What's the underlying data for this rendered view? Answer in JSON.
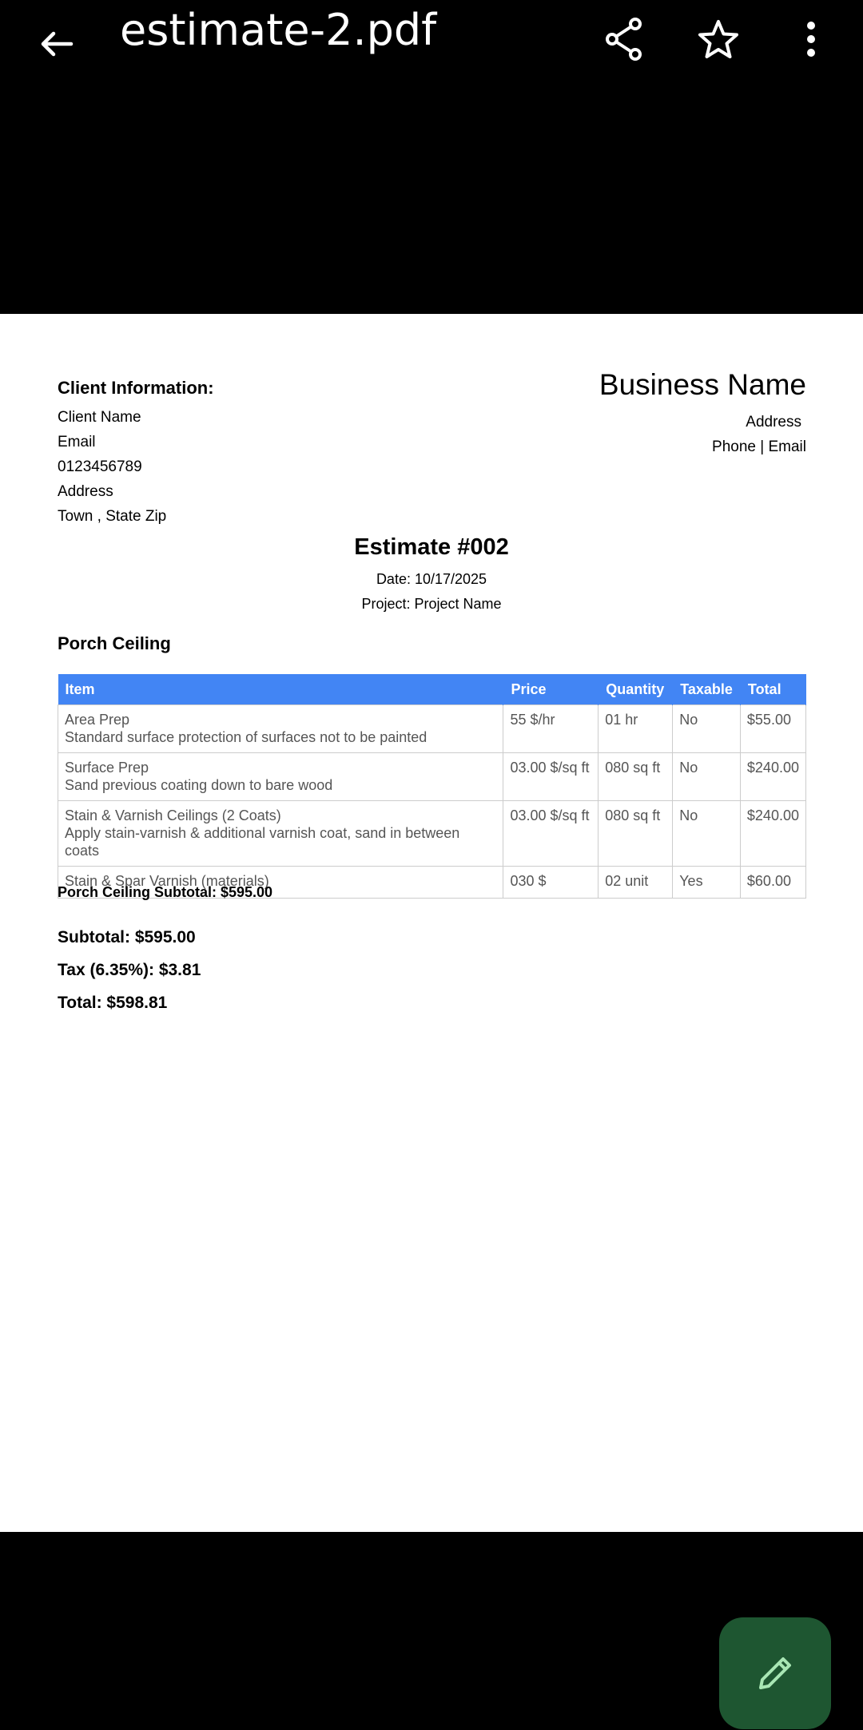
{
  "topbar": {
    "title": "estimate-2.pdf",
    "back_icon": "arrow-back-icon",
    "share_icon": "share-icon",
    "star_icon": "star-outline-icon",
    "more_icon": "more-vert-icon"
  },
  "document": {
    "client": {
      "heading": "Client Information:",
      "lines": [
        "Client  Name",
        "Email",
        "0123456789",
        "Address",
        "Town , State Zip"
      ]
    },
    "business": {
      "name": "Business Name",
      "address": "Address",
      "contact": "Phone | Email"
    },
    "estimate": {
      "title": "Estimate #002",
      "date": "Date: 10/17/2025",
      "project": "Project: Project Name"
    },
    "section": {
      "title": "Porch Ceiling",
      "subtotal": "Porch Ceiling  Subtotal: $595.00"
    },
    "table": {
      "headers": [
        "Item",
        "Price",
        "Quantity",
        "Taxable",
        "Total"
      ],
      "rows": [
        {
          "item": "Area Prep",
          "desc": "Standard surface protection of surfaces not to be painted",
          "price": "55 $/hr",
          "qty": "01 hr",
          "taxable": "No",
          "total": "$55.00"
        },
        {
          "item": "Surface Prep",
          "desc": "Sand previous coating down to bare wood",
          "price": "03.00 $/sq ft",
          "qty": "080 sq ft",
          "taxable": "No",
          "total": "$240.00"
        },
        {
          "item": "Stain & Varnish Ceilings (2 Coats)",
          "desc": "Apply stain-varnish & additional varnish coat, sand in between coats",
          "price": "03.00 $/sq ft",
          "qty": "080 sq ft",
          "taxable": "No",
          "total": "$240.00"
        },
        {
          "item": "Stain & Spar Varnish (materials)",
          "desc": "",
          "price": "030 $",
          "qty": "02 unit",
          "taxable": "Yes",
          "total": "$60.00"
        }
      ]
    },
    "totals": {
      "subtotal": "Subtotal: $595.00",
      "tax": "Tax (6.35%): $3.81",
      "total": "Total: $598.81"
    }
  },
  "fab": {
    "icon": "edit-pencil-icon",
    "color": "#1e5631",
    "icon_color": "#a8e6b4"
  },
  "colors": {
    "header_blue": "#4285f4",
    "background": "#000000"
  }
}
